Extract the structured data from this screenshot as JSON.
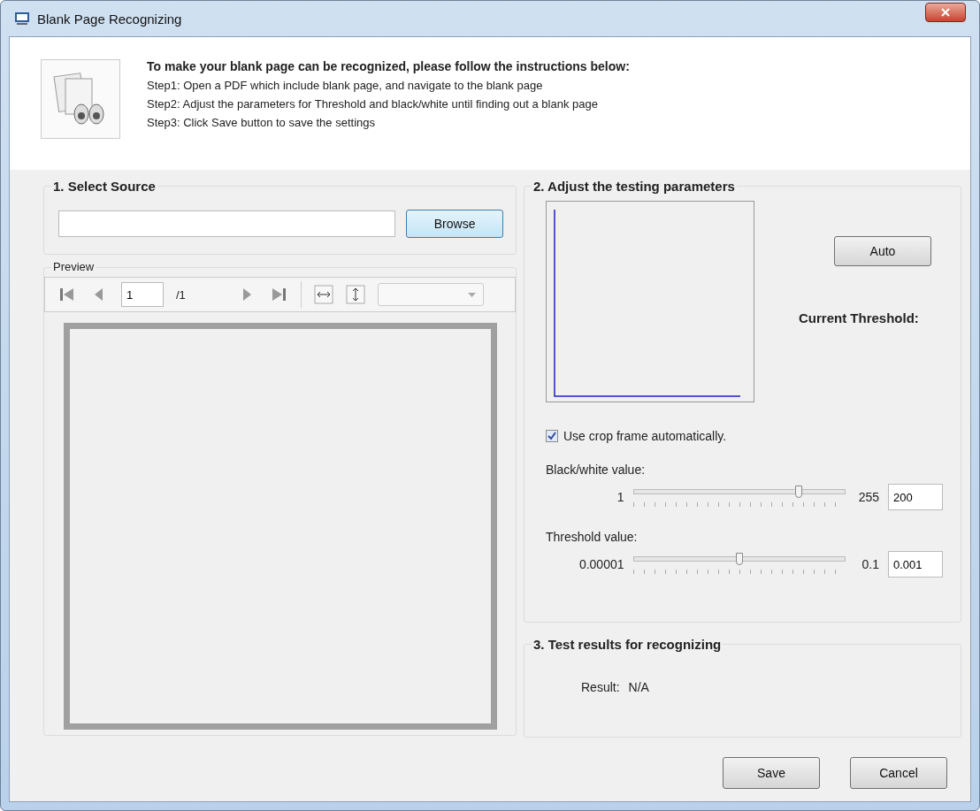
{
  "window": {
    "title": "Blank Page Recognizing"
  },
  "instructions": {
    "heading": "To make your blank page can be recognized, please follow the instructions below:",
    "steps": [
      "Step1: Open a PDF which include blank page, and navigate to the blank page",
      "Step2: Adjust the parameters for Threshold and black/white until finding out a blank page",
      "Step3: Click Save button to save the settings"
    ]
  },
  "source": {
    "title": "1. Select Source",
    "browse": "Browse"
  },
  "preview": {
    "title": "Preview",
    "page": "1",
    "page_total": "/1"
  },
  "parameters": {
    "title": "2. Adjust the testing parameters",
    "auto": "Auto",
    "current_threshold": "Current Threshold:",
    "crop": {
      "label": "Use crop frame automatically.",
      "checked": true
    },
    "sliders": [
      {
        "label": "Black/white value:",
        "min": "1",
        "max": "255",
        "value": "200",
        "level": 0.78
      },
      {
        "label": "Threshold value:",
        "min": "0.00001",
        "max": "0.1",
        "value": "0.001",
        "level": 0.5
      }
    ]
  },
  "results": {
    "title": "3. Test results for recognizing",
    "label": "Result:",
    "value": "N/A"
  },
  "buttons": [
    "Save",
    "Cancel"
  ]
}
